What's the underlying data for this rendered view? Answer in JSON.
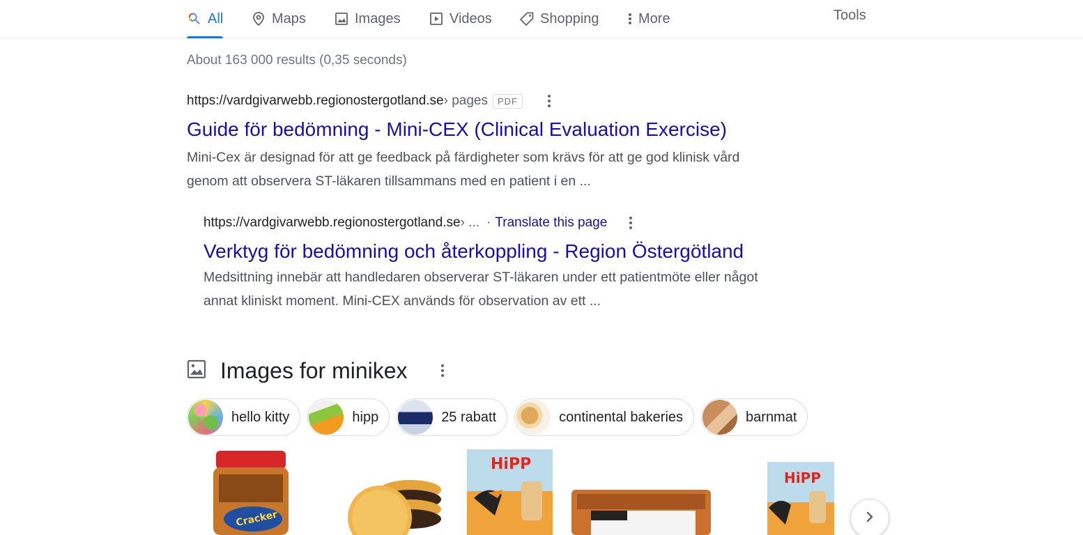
{
  "tabs": {
    "all": "All",
    "maps": "Maps",
    "images": "Images",
    "videos": "Videos",
    "shopping": "Shopping",
    "more": "More",
    "tools": "Tools"
  },
  "stats": "About 163 000 results (0,35 seconds)",
  "results": [
    {
      "cite_domain": "https://vardgivarwebb.regionostergotland.se",
      "cite_path": " › pages",
      "badge": "PDF",
      "title": "Guide för bedömning - Mini-CEX (Clinical Evaluation Exercise)",
      "snippet_line1": "Mini-Cex är designad för att ge feedback på färdigheter som krävs för att ge god klinisk vård",
      "snippet_line2": "genom att observera ST-läkaren tillsammans med en patient i en ..."
    },
    {
      "cite_domain": "https://vardgivarwebb.regionostergotland.se",
      "cite_path": " › ...",
      "separator": "·",
      "translate": "Translate this page",
      "title": "Verktyg för bedömning och återkoppling - Region Östergötland",
      "snippet_line1": "Medsittning innebär att handledaren observerar ST-läkaren under ett patientmöte eller något",
      "snippet_line2": "annat kliniskt moment. Mini-CEX används för observation av ett ..."
    }
  ],
  "images_section": {
    "title": "Images for minikex",
    "chips": [
      {
        "label": "hello kitty"
      },
      {
        "label": "hipp"
      },
      {
        "label": "25 rabatt"
      },
      {
        "label": "continental bakeries"
      },
      {
        "label": "barnmat"
      }
    ]
  },
  "colors": {
    "accent": "#1a73e8",
    "link": "#1a0dab",
    "muted": "#5f6368",
    "snippet": "#4d5156"
  }
}
